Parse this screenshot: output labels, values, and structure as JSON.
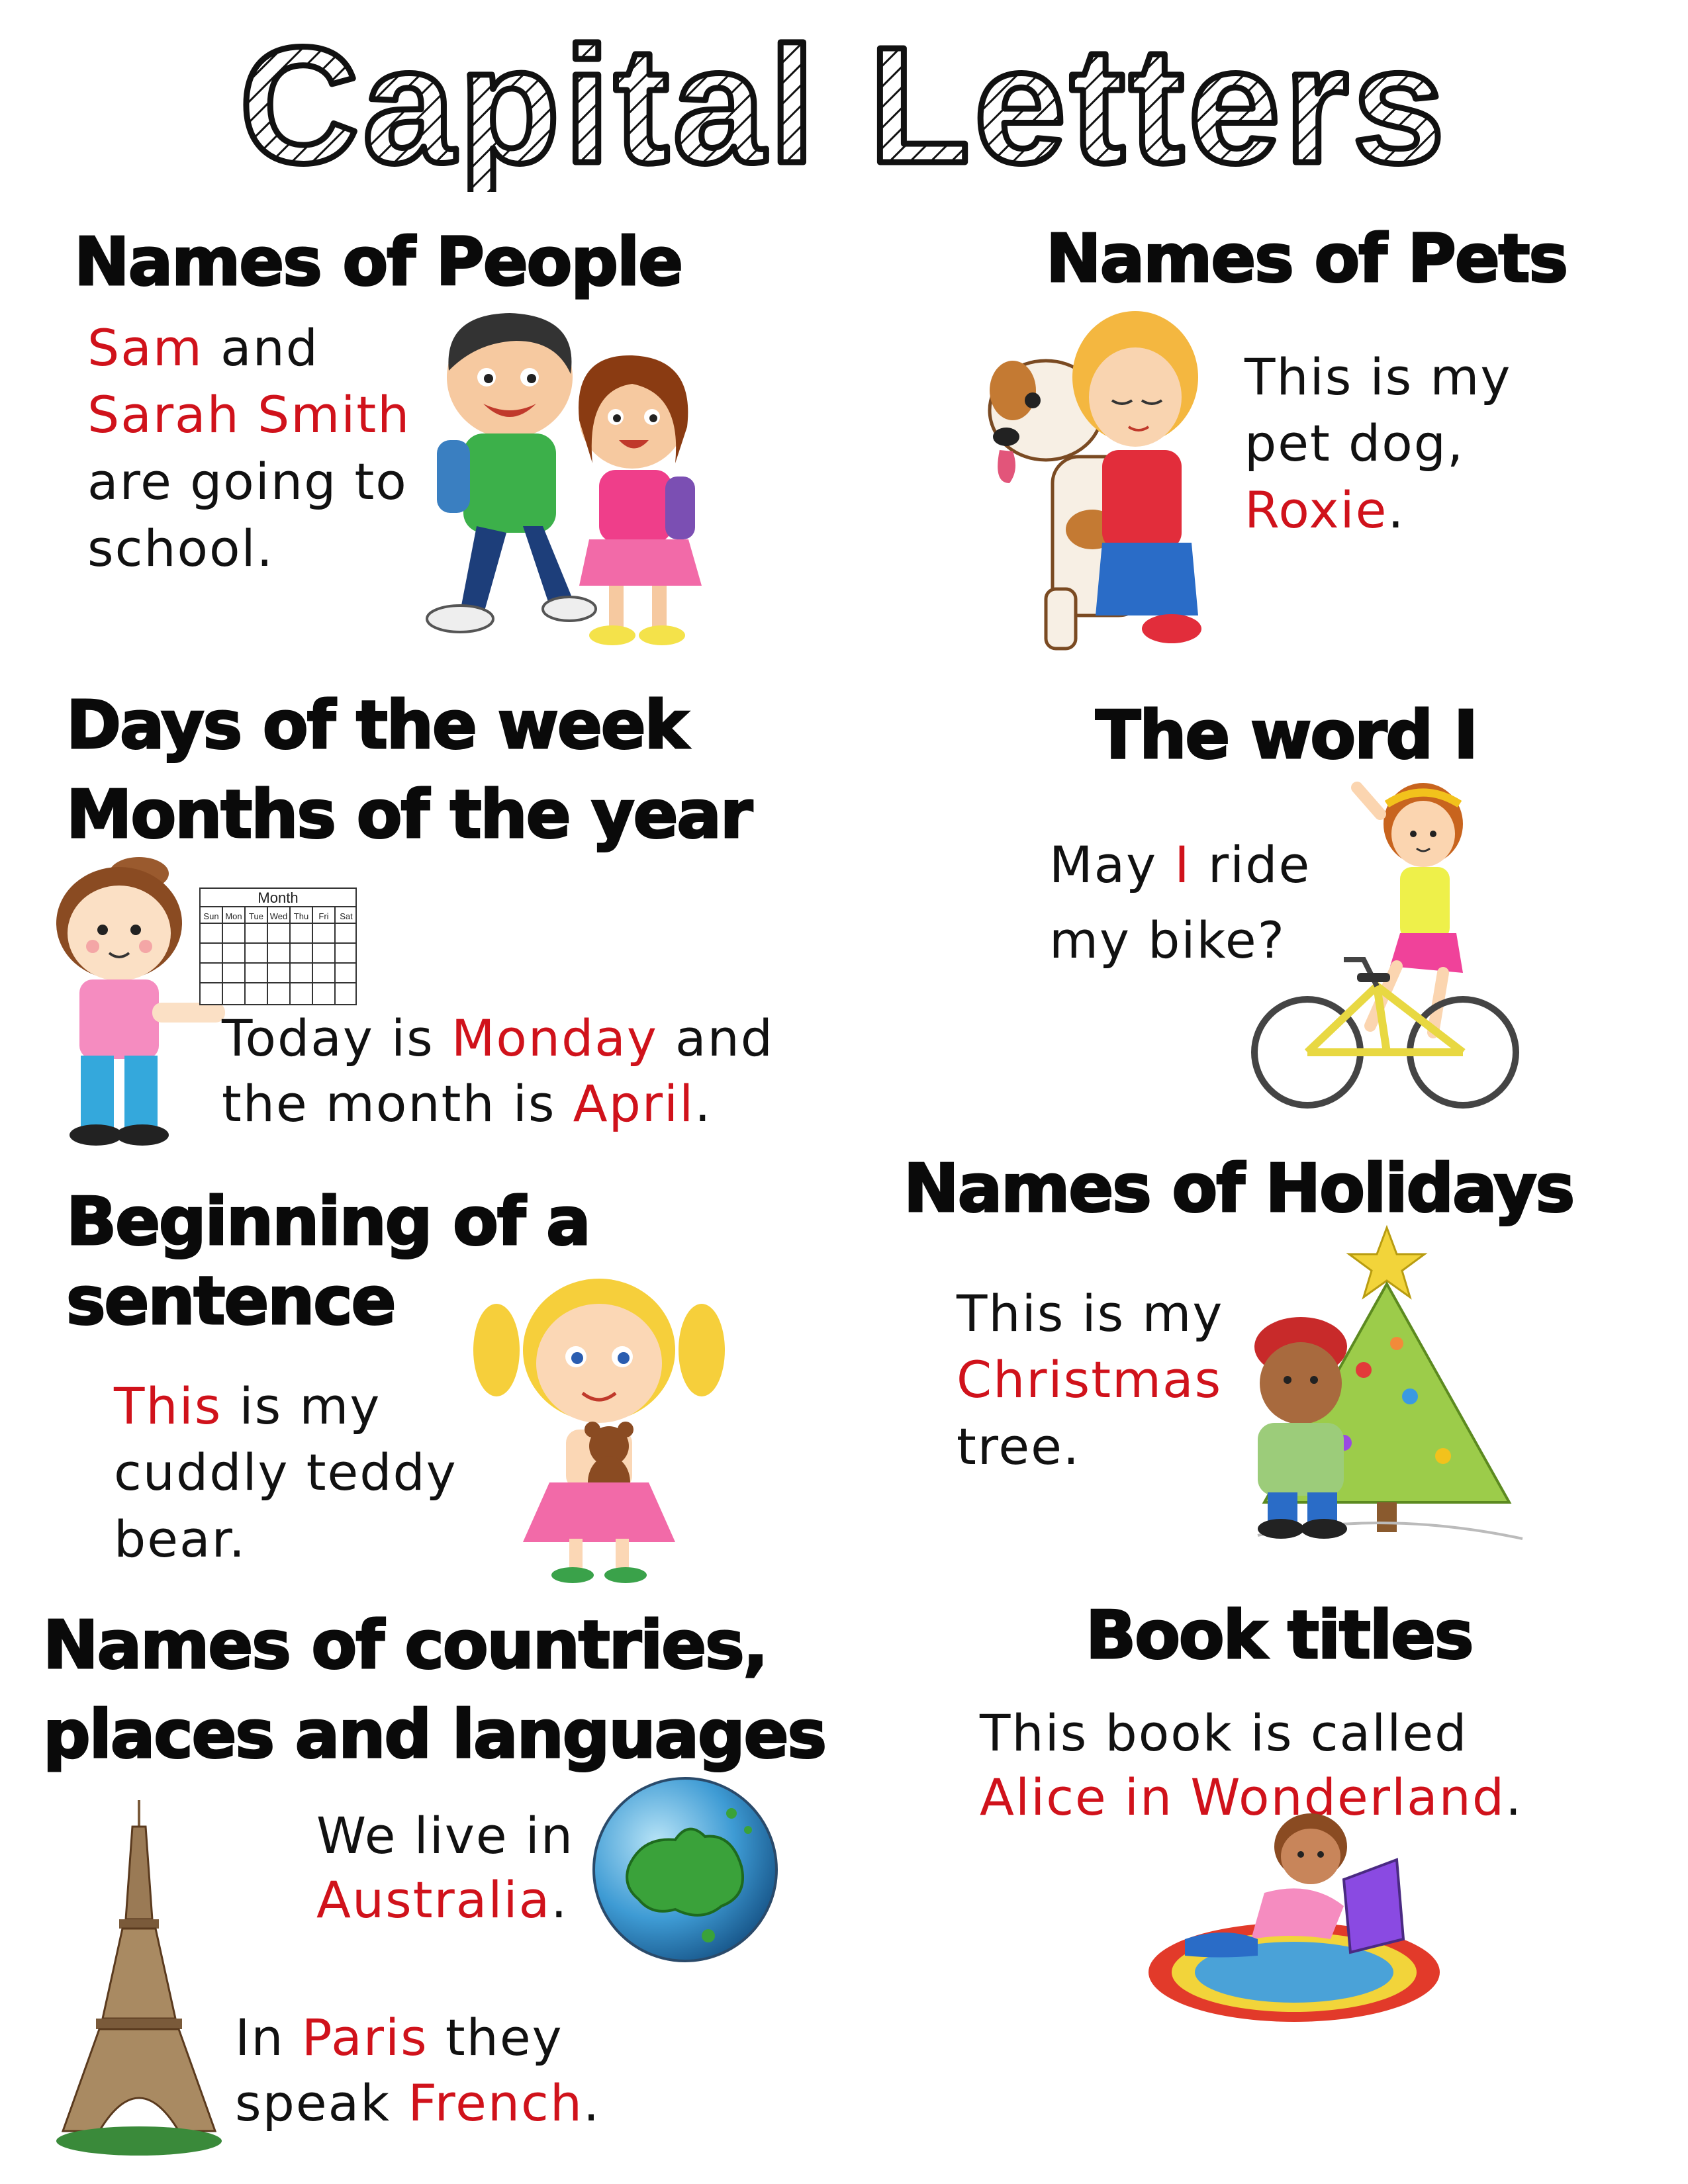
{
  "title": "Capital Letters",
  "colors": {
    "highlight": "#d0121b",
    "text": "#111111",
    "heading": "#0a0a0a"
  },
  "sections": {
    "people": {
      "heading": "Names of People",
      "lines": [
        [
          {
            "t": "Sam",
            "hl": true
          },
          {
            "t": " and",
            "hl": false
          }
        ],
        [
          {
            "t": "Sarah Smith",
            "hl": true
          }
        ],
        [
          {
            "t": "are going to",
            "hl": false
          }
        ],
        [
          {
            "t": "school.",
            "hl": false
          }
        ]
      ]
    },
    "pets": {
      "heading": "Names of Pets",
      "lines": [
        [
          {
            "t": "This is my",
            "hl": false
          }
        ],
        [
          {
            "t": "pet dog,",
            "hl": false
          }
        ],
        [
          {
            "t": "Roxie",
            "hl": true
          },
          {
            "t": ".",
            "hl": false
          }
        ]
      ]
    },
    "days": {
      "heading1": "Days of the week",
      "heading2": "Months of the year",
      "calendar_title": "Month",
      "calendar_days": [
        "Sun",
        "Mon",
        "Tue",
        "Wed",
        "Thu",
        "Fri",
        "Sat"
      ],
      "lines": [
        [
          {
            "t": "Today is ",
            "hl": false
          },
          {
            "t": "Monday",
            "hl": true
          },
          {
            "t": " and",
            "hl": false
          }
        ],
        [
          {
            "t": "the month is ",
            "hl": false
          },
          {
            "t": "April",
            "hl": true
          },
          {
            "t": ".",
            "hl": false
          }
        ]
      ]
    },
    "word_i": {
      "heading": "The word I",
      "lines": [
        [
          {
            "t": "May ",
            "hl": false
          },
          {
            "t": "I",
            "hl": true
          },
          {
            "t": " ride",
            "hl": false
          }
        ],
        [
          {
            "t": "my bike?",
            "hl": false
          }
        ]
      ]
    },
    "sentence": {
      "heading1": "Beginning of a",
      "heading2": "sentence",
      "lines": [
        [
          {
            "t": "This",
            "hl": true
          },
          {
            "t": " is my",
            "hl": false
          }
        ],
        [
          {
            "t": "cuddly teddy",
            "hl": false
          }
        ],
        [
          {
            "t": "bear.",
            "hl": false
          }
        ]
      ]
    },
    "holidays": {
      "heading": "Names of Holidays",
      "lines": [
        [
          {
            "t": "This is my",
            "hl": false
          }
        ],
        [
          {
            "t": "Christmas",
            "hl": true
          }
        ],
        [
          {
            "t": "tree.",
            "hl": false
          }
        ]
      ]
    },
    "countries": {
      "heading1": "Names of countries,",
      "heading2": "places and languages",
      "lines_a": [
        [
          {
            "t": "We live in",
            "hl": false
          }
        ],
        [
          {
            "t": "Australia",
            "hl": true
          },
          {
            "t": ".",
            "hl": false
          }
        ]
      ],
      "lines_b": [
        [
          {
            "t": "In ",
            "hl": false
          },
          {
            "t": "Paris",
            "hl": true
          },
          {
            "t": " they",
            "hl": false
          }
        ],
        [
          {
            "t": "speak ",
            "hl": false
          },
          {
            "t": "French",
            "hl": true
          },
          {
            "t": ".",
            "hl": false
          }
        ]
      ]
    },
    "books": {
      "heading": "Book titles",
      "lines": [
        [
          {
            "t": "This book is called",
            "hl": false
          }
        ],
        [
          {
            "t": "Alice in Wonderland",
            "hl": true
          },
          {
            "t": ".",
            "hl": false
          }
        ]
      ]
    }
  }
}
